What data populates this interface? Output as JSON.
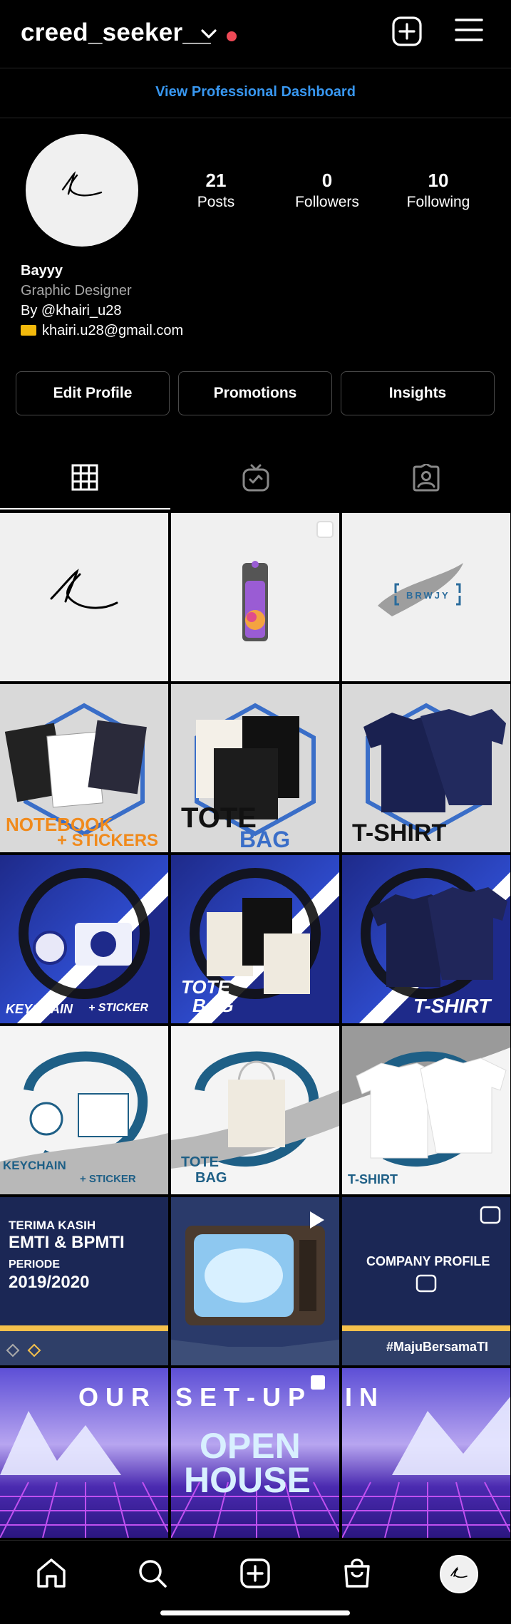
{
  "header": {
    "username": "creed_seeker__"
  },
  "dashboard_link": "View Professional Dashboard",
  "stats": {
    "posts": {
      "value": "21",
      "label": "Posts"
    },
    "followers": {
      "value": "0",
      "label": "Followers"
    },
    "following": {
      "value": "10",
      "label": "Following"
    }
  },
  "bio": {
    "name": "Bayyy",
    "category": "Graphic Designer",
    "line": "By @khairi_u28",
    "email": "khairi.u28@gmail.com"
  },
  "buttons": {
    "edit": "Edit Profile",
    "promotions": "Promotions",
    "insights": "Insights"
  },
  "posts": [
    {
      "label": "",
      "theme": "logo-k"
    },
    {
      "label": "",
      "theme": "logo-flask"
    },
    {
      "label": "BRWJY",
      "theme": "logo-brush"
    },
    {
      "label": "NOTEBOOK + STICKERS",
      "theme": "filkom"
    },
    {
      "label": "TOTE BAG",
      "theme": "filkom"
    },
    {
      "label": "T-SHIRT",
      "theme": "filkom"
    },
    {
      "label": "KEYCHAIN + STICKER",
      "theme": "blue"
    },
    {
      "label": "TOTE BAG",
      "theme": "blue"
    },
    {
      "label": "T-SHIRT",
      "theme": "blue"
    },
    {
      "label": "KEYCHAIN + STICKER",
      "theme": "white"
    },
    {
      "label": "TOTE BAG",
      "theme": "white"
    },
    {
      "label": "T-SHIRT",
      "theme": "white"
    },
    {
      "label": "TERIMA KASIH EMTI & BPMTI PERIODE 2019/2020",
      "theme": "navy"
    },
    {
      "label": "",
      "theme": "tv"
    },
    {
      "label": "COMPANY PROFILE #MajuBersamaTI",
      "theme": "navy"
    },
    {
      "label": "OUR",
      "theme": "purple"
    },
    {
      "label": "SET-UP IN OPEN HOUSE",
      "theme": "purple"
    },
    {
      "label": "IN",
      "theme": "purple"
    }
  ],
  "texts": {
    "p3": "BRWJY",
    "p4a": "NOTEBOOK",
    "p4b": "+ STICKERS",
    "p5a": "TOTE",
    "p5b": "BAG",
    "p6": "T-SHIRT",
    "p7a": "KEYCHAIN",
    "p7b": "+ STICKER",
    "p8a": "TOTE",
    "p8b": "BAG",
    "p9": "T-SHIRT",
    "p10a": "KEYCHAIN",
    "p10b": "+ STICKER",
    "p11a": "TOTE",
    "p11b": "BAG",
    "p12": "T-SHIRT",
    "p13a": "TERIMA KASIH",
    "p13b": "EMTI & BPMTI",
    "p13c": "PERIODE",
    "p13d": "2019/2020",
    "p15a": "COMPANY PROFILE",
    "p15b": "#MajuBersamaTI",
    "p16": "O U R",
    "p17a": "S E T - U P",
    "p17b": "OPEN",
    "p17c": "HOUSE",
    "p18": "I N"
  },
  "colors": {
    "accent_link": "#3897f0",
    "notification_dot": "#ed4956",
    "border": "#262626"
  }
}
